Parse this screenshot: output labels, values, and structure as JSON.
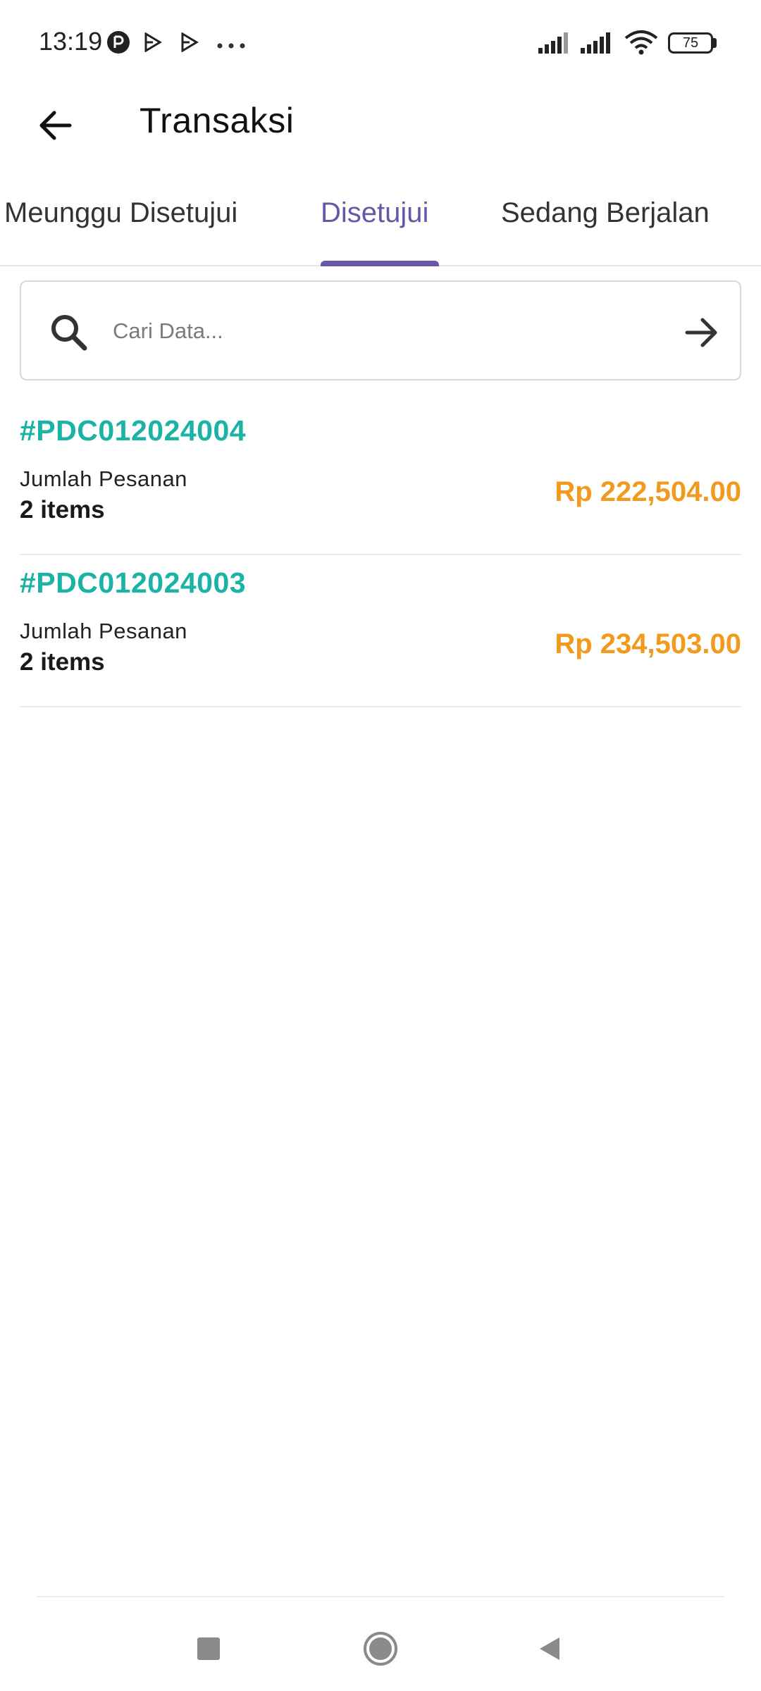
{
  "status_bar": {
    "time": "13:19",
    "battery": "75"
  },
  "app_bar": {
    "title": "Transaksi",
    "back_icon": "arrow-left-icon"
  },
  "tabs": [
    {
      "label": "Meunggu Disetujui",
      "active": false
    },
    {
      "label": "Disetujui",
      "active": true
    },
    {
      "label": "Sedang Berjalan",
      "active": false
    }
  ],
  "search": {
    "placeholder": "Cari Data...",
    "value": "",
    "icon": "search-icon",
    "submit_icon": "arrow-right-icon"
  },
  "orders": [
    {
      "code": "#PDC012024004",
      "qty_label": "Jumlah Pesanan",
      "qty": "2 items",
      "total": "Rp 222,504.00"
    },
    {
      "code": "#PDC012024003",
      "qty_label": "Jumlah Pesanan",
      "qty": "2 items",
      "total": "Rp 234,503.00"
    }
  ],
  "colors": {
    "accent": "#6a56a6",
    "order_code": "#1bb3a5",
    "total": "#f29a1e"
  },
  "nav_bar": {
    "icons": [
      "square-icon",
      "circle-icon",
      "triangle-back-icon"
    ]
  }
}
